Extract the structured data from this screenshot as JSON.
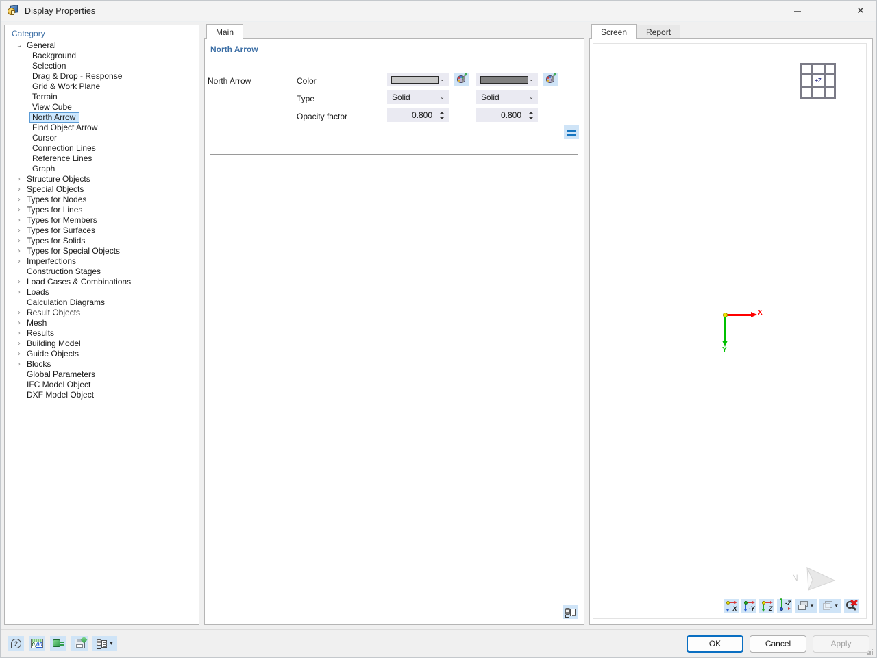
{
  "window": {
    "title": "Display Properties",
    "icon": "display-properties-icon",
    "minimize_label": "Minimize",
    "maximize_label": "Maximize",
    "close_label": "Close"
  },
  "tree": {
    "header": "Category",
    "items": [
      {
        "label": "General",
        "level": 0,
        "expander": "expanded",
        "selected": false
      },
      {
        "label": "Background",
        "level": 1,
        "expander": "none",
        "selected": false
      },
      {
        "label": "Selection",
        "level": 1,
        "expander": "none",
        "selected": false
      },
      {
        "label": "Drag & Drop - Response",
        "level": 1,
        "expander": "none",
        "selected": false
      },
      {
        "label": "Grid & Work Plane",
        "level": 1,
        "expander": "none",
        "selected": false
      },
      {
        "label": "Terrain",
        "level": 1,
        "expander": "none",
        "selected": false
      },
      {
        "label": "View Cube",
        "level": 1,
        "expander": "none",
        "selected": false
      },
      {
        "label": "North Arrow",
        "level": 1,
        "expander": "none",
        "selected": true
      },
      {
        "label": "Find Object Arrow",
        "level": 1,
        "expander": "none",
        "selected": false
      },
      {
        "label": "Cursor",
        "level": 1,
        "expander": "none",
        "selected": false
      },
      {
        "label": "Connection Lines",
        "level": 1,
        "expander": "none",
        "selected": false
      },
      {
        "label": "Reference Lines",
        "level": 1,
        "expander": "none",
        "selected": false
      },
      {
        "label": "Graph",
        "level": 1,
        "expander": "none",
        "selected": false
      },
      {
        "label": "Structure Objects",
        "level": 0,
        "expander": "collapsed",
        "selected": false
      },
      {
        "label": "Special Objects",
        "level": 0,
        "expander": "collapsed",
        "selected": false
      },
      {
        "label": "Types for Nodes",
        "level": 0,
        "expander": "collapsed",
        "selected": false
      },
      {
        "label": "Types for Lines",
        "level": 0,
        "expander": "collapsed",
        "selected": false
      },
      {
        "label": "Types for Members",
        "level": 0,
        "expander": "collapsed",
        "selected": false
      },
      {
        "label": "Types for Surfaces",
        "level": 0,
        "expander": "collapsed",
        "selected": false
      },
      {
        "label": "Types for Solids",
        "level": 0,
        "expander": "collapsed",
        "selected": false
      },
      {
        "label": "Types for Special Objects",
        "level": 0,
        "expander": "collapsed",
        "selected": false
      },
      {
        "label": "Imperfections",
        "level": 0,
        "expander": "collapsed",
        "selected": false
      },
      {
        "label": "Construction Stages",
        "level": 0,
        "expander": "none",
        "selected": false
      },
      {
        "label": "Load Cases & Combinations",
        "level": 0,
        "expander": "collapsed",
        "selected": false
      },
      {
        "label": "Loads",
        "level": 0,
        "expander": "collapsed",
        "selected": false
      },
      {
        "label": "Calculation Diagrams",
        "level": 0,
        "expander": "none",
        "selected": false
      },
      {
        "label": "Result Objects",
        "level": 0,
        "expander": "collapsed",
        "selected": false
      },
      {
        "label": "Mesh",
        "level": 0,
        "expander": "collapsed",
        "selected": false
      },
      {
        "label": "Results",
        "level": 0,
        "expander": "collapsed",
        "selected": false
      },
      {
        "label": "Building Model",
        "level": 0,
        "expander": "collapsed",
        "selected": false
      },
      {
        "label": "Guide Objects",
        "level": 0,
        "expander": "collapsed",
        "selected": false
      },
      {
        "label": "Blocks",
        "level": 0,
        "expander": "collapsed",
        "selected": false
      },
      {
        "label": "Global Parameters",
        "level": 0,
        "expander": "none",
        "selected": false
      },
      {
        "label": "IFC Model Object",
        "level": 0,
        "expander": "none",
        "selected": false
      },
      {
        "label": "DXF Model Object",
        "level": 0,
        "expander": "none",
        "selected": false
      }
    ]
  },
  "settings": {
    "tab_main": "Main",
    "section_title": "North Arrow",
    "column_screen": "Screen",
    "column_report": "Report",
    "group_label": "North Arrow",
    "rows": {
      "color_label": "Color",
      "type_label": "Type",
      "opacity_label": "Opacity factor"
    },
    "screen": {
      "color_value": "#c8c8c8",
      "type_value": "Solid",
      "opacity_value": "0.800"
    },
    "report": {
      "color_value": "#808080",
      "type_value": "Solid",
      "opacity_value": "0.800"
    },
    "equalize_button": "=",
    "palette_button": "color-palette"
  },
  "preview": {
    "tabs": [
      {
        "label": "Screen",
        "active": true
      },
      {
        "label": "Report",
        "active": false
      }
    ],
    "viewcube_label": "+Z",
    "axis_x_label": "X",
    "axis_y_label": "Y",
    "axis_x_color": "#ff0000",
    "axis_y_color": "#00c000",
    "north_label": "N",
    "toolbar": [
      {
        "name": "view-x",
        "label": "X"
      },
      {
        "name": "view-minus-y",
        "label": "-Y"
      },
      {
        "name": "view-z",
        "label": "Z"
      },
      {
        "name": "view-minus-z",
        "label": "-Z"
      },
      {
        "name": "render-mode",
        "label": ""
      },
      {
        "name": "wireframe-mode",
        "label": ""
      },
      {
        "name": "zoom-reset",
        "label": ""
      }
    ]
  },
  "footer": {
    "left_buttons": [
      {
        "name": "help",
        "label": ""
      },
      {
        "name": "units",
        "label": "0,00"
      },
      {
        "name": "addon",
        "label": ""
      },
      {
        "name": "save-config",
        "label": ""
      },
      {
        "name": "load-config",
        "label": ""
      }
    ],
    "ok": "OK",
    "cancel": "Cancel",
    "apply": "Apply"
  },
  "colors": {
    "accent": "#0a6fc2",
    "header_blue": "#3b6ea5",
    "selection": "#cde8ff",
    "button_face": "#cfe4f7"
  }
}
